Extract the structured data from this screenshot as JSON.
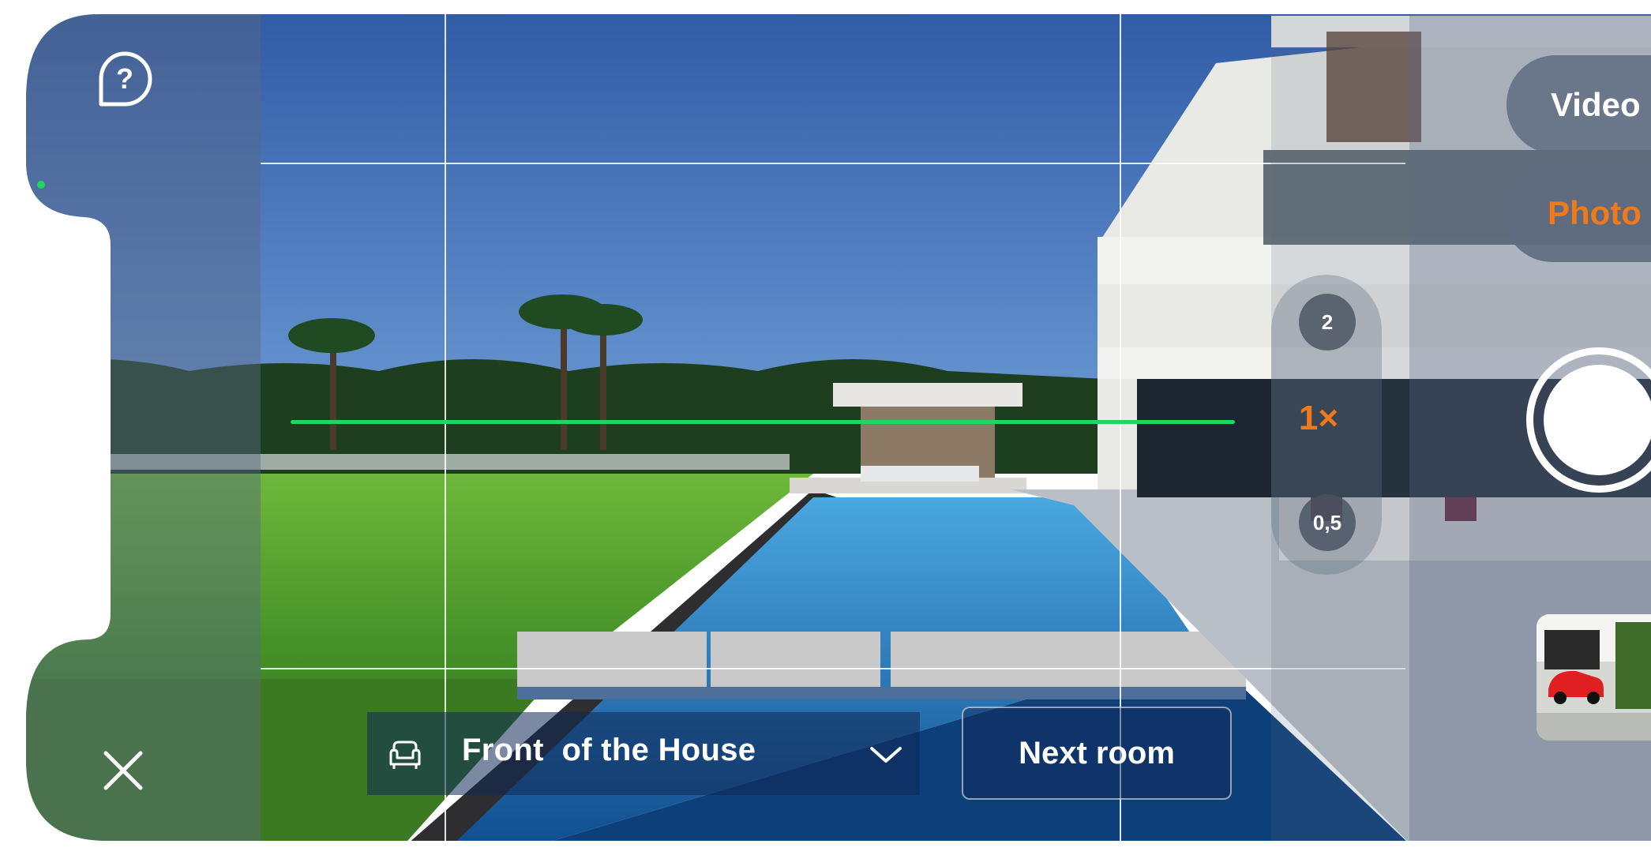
{
  "help": {
    "icon": "help-bubble-icon"
  },
  "close": {
    "icon": "close-icon"
  },
  "room_selector": {
    "icon": "armchair-icon",
    "label": "Front  of the House",
    "chevron": "chevron-down-icon"
  },
  "next_room": {
    "label": "Next room"
  },
  "modes": {
    "video": "Video",
    "photo": "Photo",
    "active": "photo"
  },
  "zoom": {
    "options": [
      "2",
      "1×",
      "0,5"
    ],
    "active": "1×"
  },
  "colors": {
    "accent": "#f07a1a",
    "level_indicator": "#1ed760",
    "panel": "#5a6982"
  },
  "shutter": {
    "icon": "shutter-button"
  },
  "last_capture": {
    "icon": "photo-thumbnail"
  }
}
